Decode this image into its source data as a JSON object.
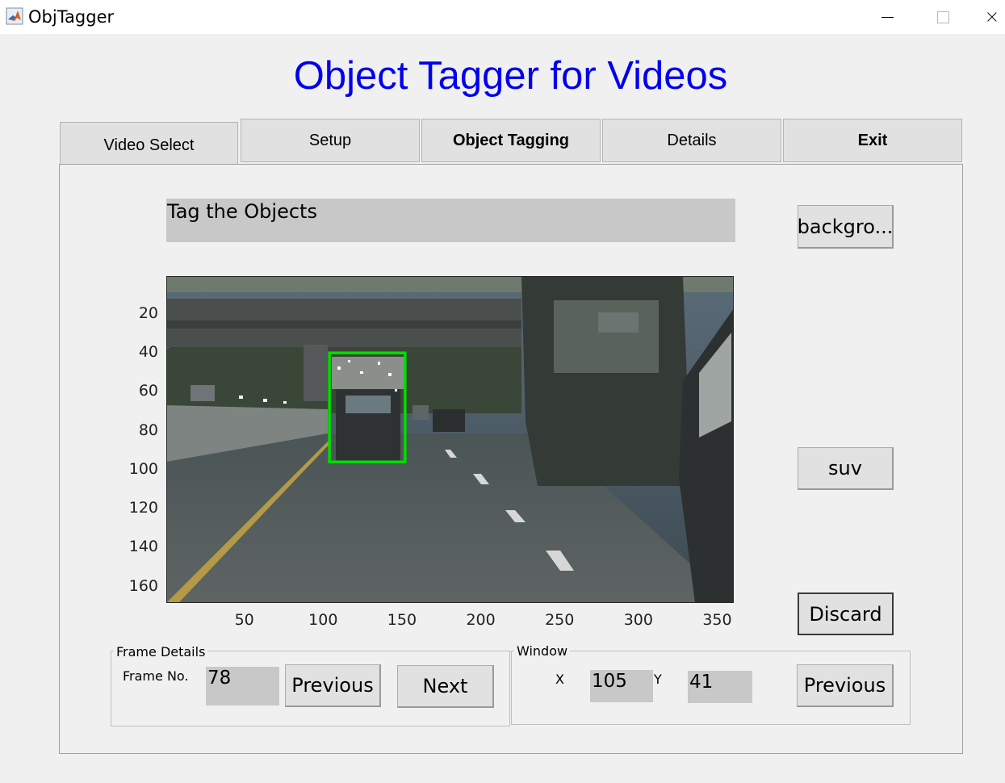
{
  "window": {
    "title": "ObjTagger",
    "icon": "matlab-icon",
    "controls": [
      "minimize-icon",
      "maximize-icon",
      "close-icon"
    ]
  },
  "app_title": "Object Tagger for Videos",
  "tabs": [
    {
      "label": "Video Select",
      "active": true
    },
    {
      "label": "Setup",
      "active": false
    },
    {
      "label": "Object Tagging",
      "active": false
    },
    {
      "label": "Details",
      "active": false
    },
    {
      "label": "Exit",
      "active": false
    }
  ],
  "status_text": "Tag the Objects",
  "buttons": {
    "background": "backgro...",
    "suv": "suv",
    "discard": "Discard"
  },
  "image_axes": {
    "x_ticks": [
      "50",
      "100",
      "150",
      "200",
      "250",
      "300",
      "350"
    ],
    "y_ticks": [
      "20",
      "40",
      "60",
      "80",
      "100",
      "120",
      "140",
      "160"
    ],
    "x_range": [
      0.5,
      360.5
    ],
    "y_range": [
      0.5,
      168.5
    ],
    "bounding_box": {
      "x_start": 104,
      "x_end": 152,
      "y_start": 40,
      "y_end": 96,
      "color": "#00dd00"
    }
  },
  "frame_details": {
    "group_label": "Frame Details",
    "frame_label": "Frame No.",
    "frame_value": "78",
    "previous_label": "Previous",
    "next_label": "Next"
  },
  "window_group": {
    "group_label": "Window",
    "x_label": "X",
    "x_value": "105",
    "y_label": "Y",
    "y_value": "41",
    "previous_label": "Previous"
  },
  "colors": {
    "title_blue": "#0000ee",
    "field_gray": "#c8c8c8",
    "box_green": "#00dd00"
  }
}
